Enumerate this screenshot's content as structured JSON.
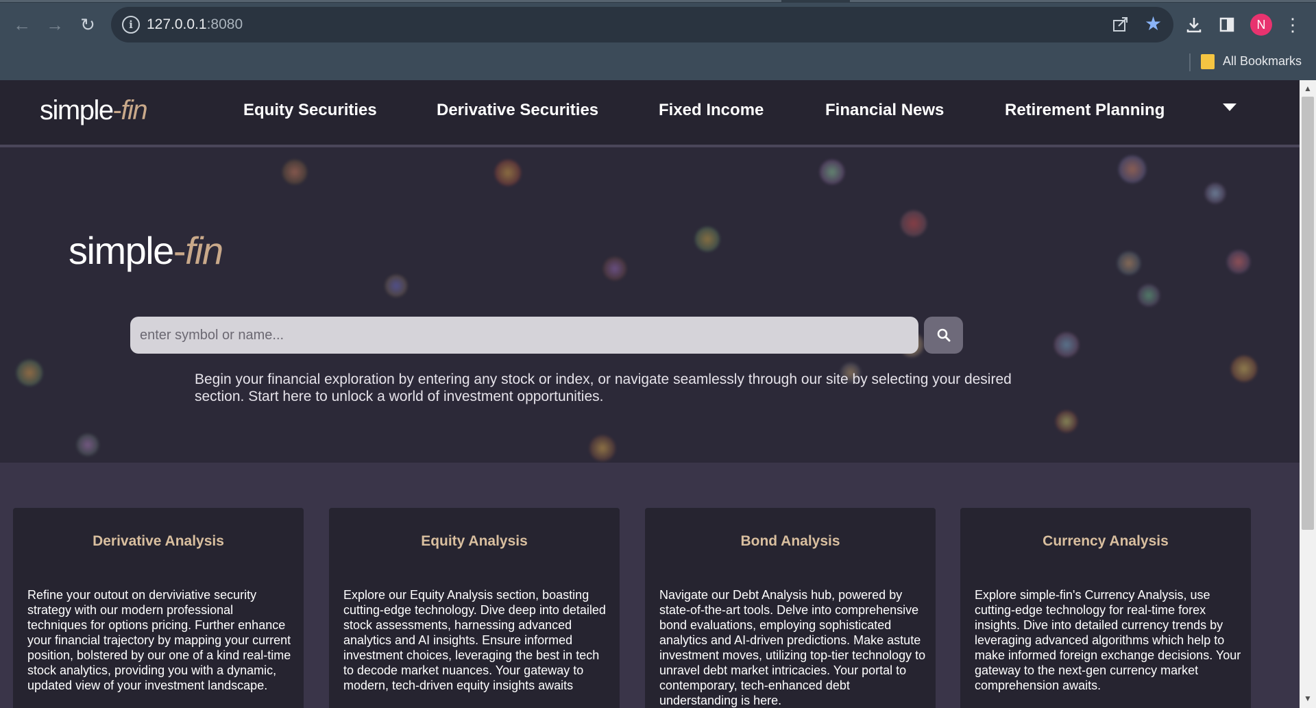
{
  "browser": {
    "url_host": "127.0.0.1",
    "url_port": ":8080",
    "avatar_letter": "N",
    "bookmarks_label": "All Bookmarks"
  },
  "site": {
    "logo_a": "simple",
    "logo_dash": "-",
    "logo_b": "fin",
    "nav": [
      "Equity Securities",
      "Derivative Securities",
      "Fixed Income",
      "Financial News",
      "Retirement Planning"
    ]
  },
  "hero": {
    "search_placeholder": "enter symbol or name...",
    "intro": "Begin your financial exploration by entering any stock or index, or navigate seamlessly through our site by selecting your desired section. Start here to unlock a world of investment opportunities."
  },
  "cards": [
    {
      "title": "Derivative Analysis",
      "body": "Refine your outout on derviviative security strategy with our modern professional techniques for options pricing. Further enhance your financial trajectory by mapping your current position, bolstered by our one of a kind real-time stock analytics, providing you with a dynamic, updated view of your investment landscape."
    },
    {
      "title": "Equity Analysis",
      "body": "Explore our Equity Analysis section, boasting cutting-edge technology. Dive deep into detailed stock assessments, harnessing advanced analytics and AI insights. Ensure informed investment choices, leveraging the best in tech to decode market nuances. Your gateway to modern, tech-driven equity insights awaits"
    },
    {
      "title": "Bond Analysis",
      "body": "Navigate our Debt Analysis hub, powered by state-of-the-art tools. Delve into comprehensive bond evaluations, employing sophisticated analytics and AI-driven predictions. Make astute investment moves, utilizing top-tier technology to unravel debt market intricacies. Your portal to contemporary, tech-enhanced debt understanding is here."
    },
    {
      "title": "Currency Analysis",
      "body": "Explore simple-fin's Currency Analysis, use cutting-edge technology for real-time forex insights. Dive into detailed currency trends by leveraging advanced algorithms which help to make informed foreign exchange decisions. Your gateway to the next-gen currency market comprehension awaits."
    }
  ]
}
